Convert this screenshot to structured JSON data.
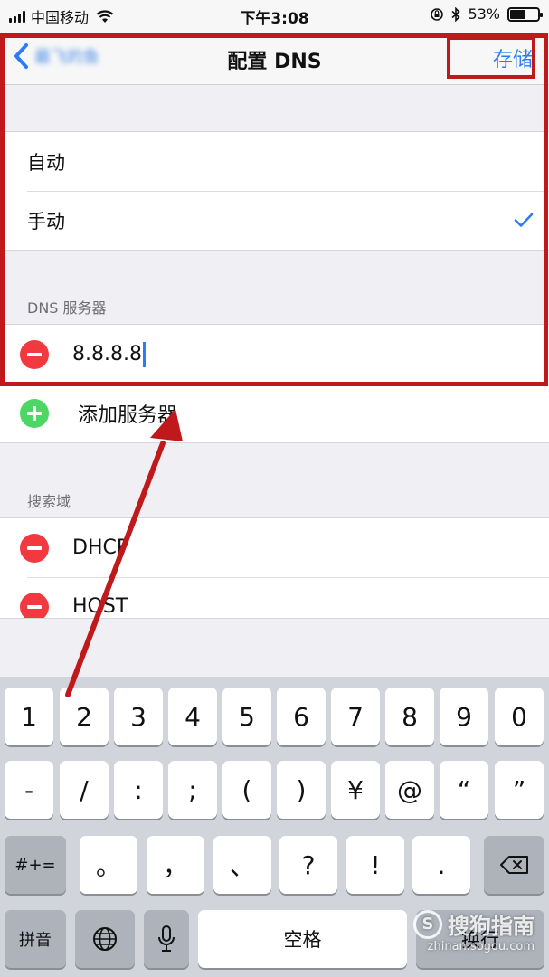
{
  "status_bar": {
    "carrier": "中国移动",
    "time": "下午3:08",
    "battery_text": "53%",
    "battery_level": 0.53
  },
  "nav": {
    "back_label": "最飞的鱼",
    "title": "配置 DNS",
    "save_label": "存储"
  },
  "config_mode": {
    "options": [
      {
        "label": "自动",
        "selected": false
      },
      {
        "label": "手动",
        "selected": true
      }
    ]
  },
  "dns_servers": {
    "header": "DNS 服务器",
    "entries": [
      "8.8.8.8"
    ],
    "add_label": "添加服务器"
  },
  "search_domains": {
    "header": "搜索域",
    "entries": [
      "DHCP",
      "HOST"
    ]
  },
  "keyboard": {
    "row1": [
      "1",
      "2",
      "3",
      "4",
      "5",
      "6",
      "7",
      "8",
      "9",
      "0"
    ],
    "row2": [
      "-",
      "/",
      ":",
      ";",
      "(",
      ")",
      "¥",
      "@",
      "“",
      "”"
    ],
    "row3_switch": "#+=",
    "row3": [
      "。",
      "，",
      "、",
      "?",
      "!",
      "."
    ],
    "pinyin": "拼音",
    "space": "空格",
    "return": "换行"
  },
  "watermark": {
    "brand": "搜狗指南",
    "url": "zhinan.sogou.com"
  },
  "colors": {
    "accent": "#2b7cf5",
    "annotation_red": "#c0191b",
    "delete_red": "#f2393f",
    "add_green": "#4cd663"
  },
  "icons": {
    "back": "chevron-left-icon",
    "check": "checkmark-icon",
    "delete": "minus-circle-icon",
    "add": "plus-circle-icon",
    "backspace": "backspace-icon",
    "globe": "globe-icon",
    "mic": "microphone-icon"
  }
}
